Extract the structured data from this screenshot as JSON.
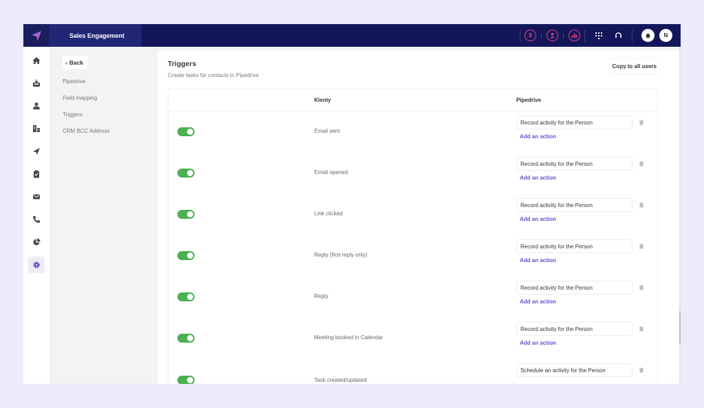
{
  "header": {
    "app_title": "Sales Engagement",
    "brand_color": "#13175a",
    "icons": [
      "dollar-icon",
      "user-icon",
      "chart-icon",
      "dialpad-icon",
      "headset-icon",
      "bell-icon"
    ],
    "avatar_initial": "N"
  },
  "rail": {
    "items": [
      {
        "name": "home",
        "active": false
      },
      {
        "name": "inbox",
        "active": false
      },
      {
        "name": "contacts",
        "active": false
      },
      {
        "name": "companies",
        "active": false
      },
      {
        "name": "campaigns",
        "active": false
      },
      {
        "name": "tasks",
        "active": false
      },
      {
        "name": "mail",
        "active": false
      },
      {
        "name": "calls",
        "active": false
      },
      {
        "name": "reports",
        "active": false
      },
      {
        "name": "settings",
        "active": true
      }
    ]
  },
  "subnav": {
    "back_label": "Back",
    "items": [
      "Pipedrive",
      "Field mapping",
      "Triggers",
      "CRM BCC Address"
    ]
  },
  "main": {
    "title": "Triggers",
    "subtitle": "Create tasks for contacts in Pipedrive",
    "copy_label": "Copy to all users",
    "columns": {
      "klenty": "Klenty",
      "pipedrive": "Pipedrive"
    },
    "add_action_label": "Add an action",
    "rows": [
      {
        "trigger": "Email sent",
        "enabled": true,
        "action": "Record activity for the Person"
      },
      {
        "trigger": "Email opened",
        "enabled": true,
        "action": "Record activity for the Person"
      },
      {
        "trigger": "Link clicked",
        "enabled": true,
        "action": "Record activity for the Person"
      },
      {
        "trigger": "Reply (first reply only)",
        "enabled": true,
        "action": "Record activity for the Person"
      },
      {
        "trigger": "Reply",
        "enabled": true,
        "action": "Record activity for the Person"
      },
      {
        "trigger": "Meeting booked in Calendar",
        "enabled": true,
        "action": "Record activity for the Person"
      },
      {
        "trigger": "Task created/updated",
        "enabled": true,
        "action": "Schedule an activity for the Person"
      }
    ]
  }
}
